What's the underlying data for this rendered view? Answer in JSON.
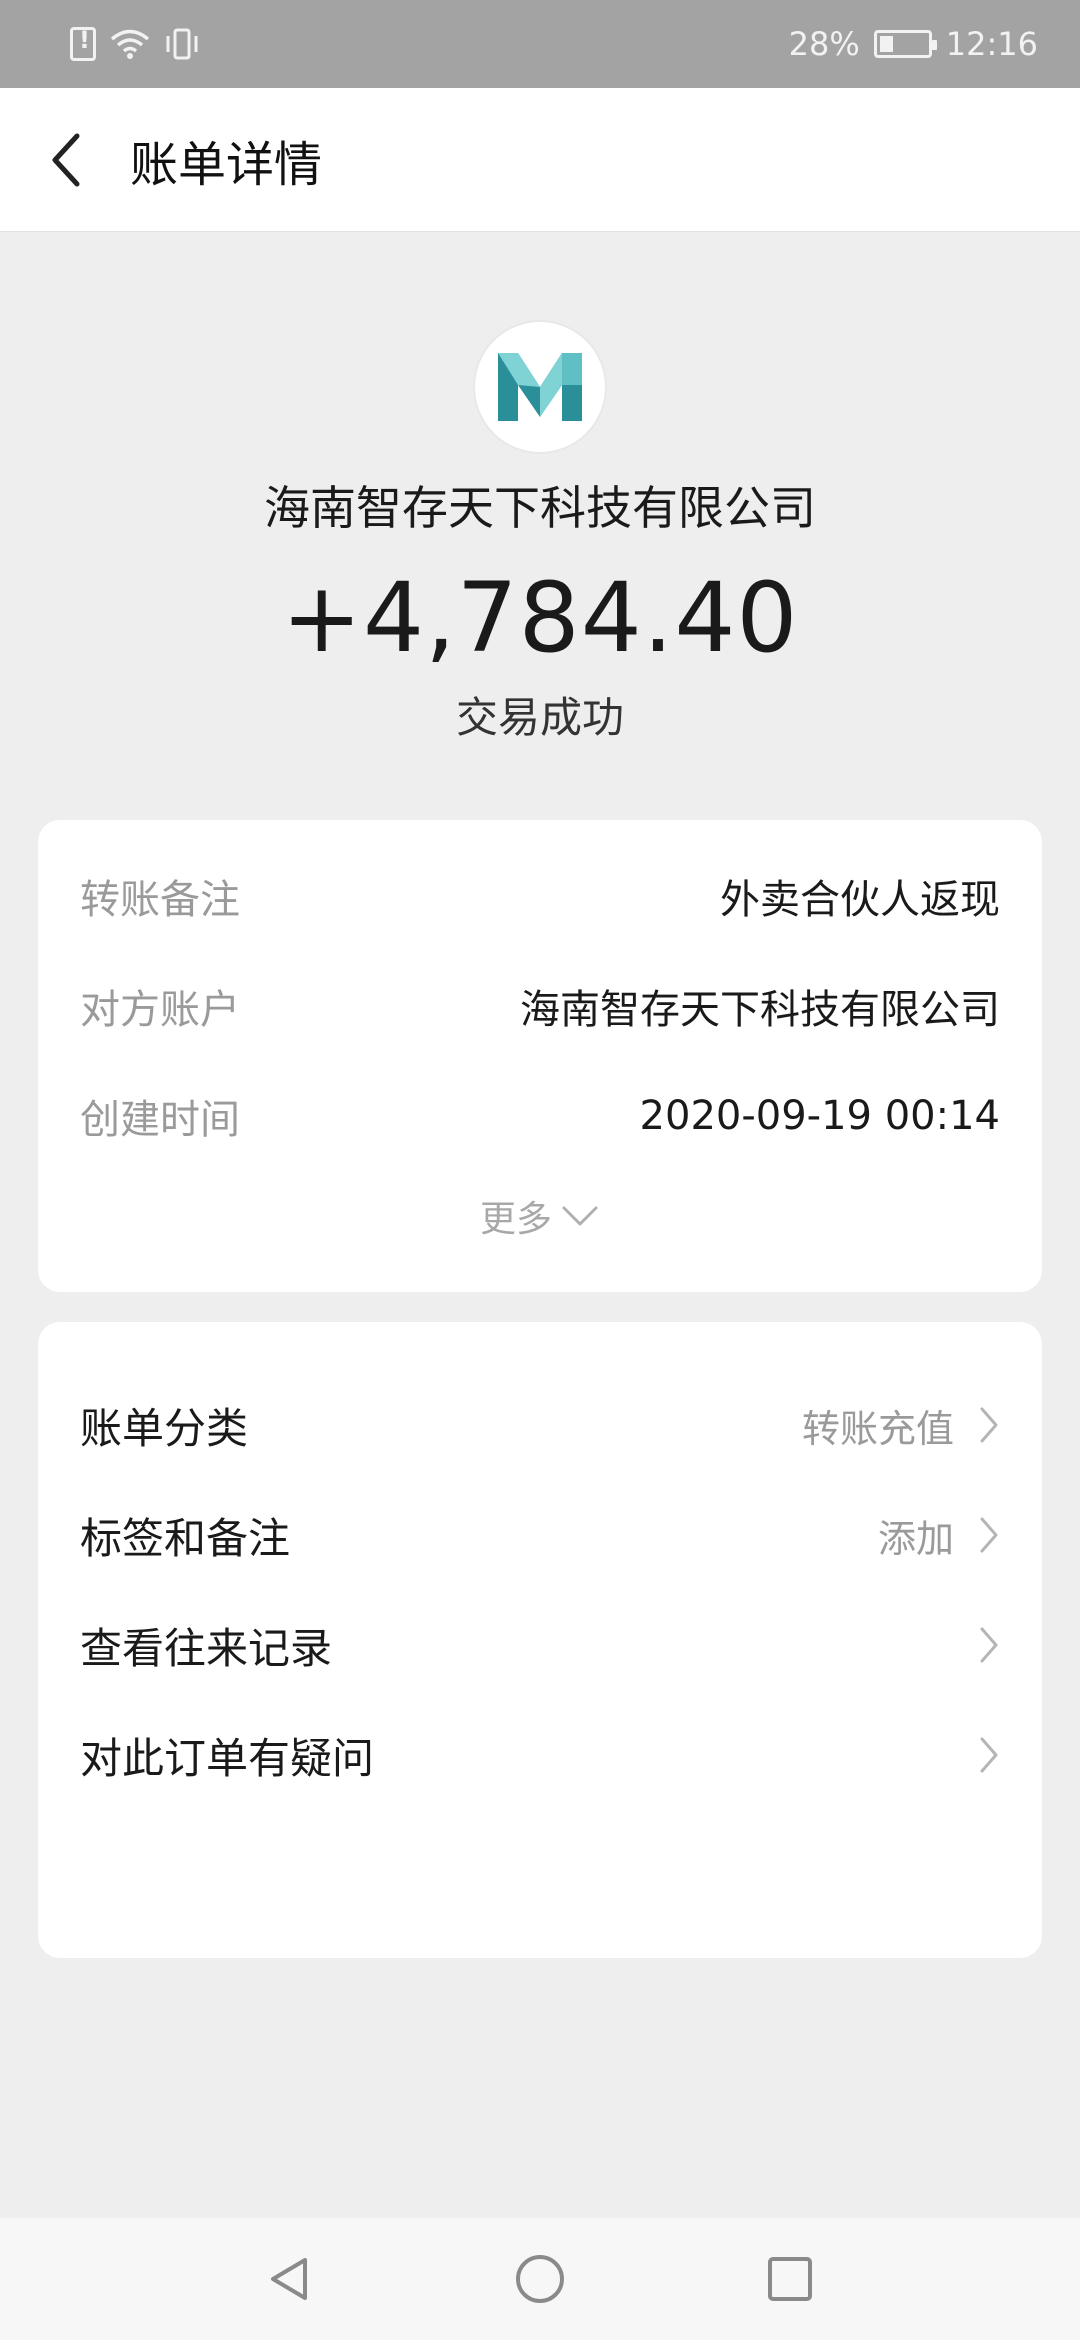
{
  "status_bar": {
    "battery": "28%",
    "time": "12:16",
    "battery_level": 0.28,
    "icons": [
      "sim-alert-icon",
      "wifi-icon",
      "vibrate-icon",
      "battery-icon"
    ]
  },
  "header": {
    "back_icon": "chevron-left-icon",
    "title": "账单详情"
  },
  "summary": {
    "merchant_logo": "M-logo",
    "merchant_name": "海南智存天下科技有限公司",
    "amount": "+4,784.40",
    "status": "交易成功"
  },
  "details": {
    "rows": [
      {
        "label": "转账备注",
        "value": "外卖合伙人返现"
      },
      {
        "label": "对方账户",
        "value": "海南智存天下科技有限公司"
      },
      {
        "label": "创建时间",
        "value": "2020-09-19 00:14"
      }
    ],
    "more_label": "更多",
    "more_icon": "chevron-down-icon"
  },
  "actions": {
    "rows": [
      {
        "label": "账单分类",
        "value": "转账充值"
      },
      {
        "label": "标签和备注",
        "value": "添加"
      },
      {
        "label": "查看往来记录",
        "value": ""
      },
      {
        "label": "对此订单有疑问",
        "value": ""
      }
    ],
    "chevron_icon": "chevron-right-icon"
  },
  "nav_bar": {
    "icons": [
      "nav-back-icon",
      "nav-home-icon",
      "nav-recents-icon"
    ]
  },
  "colors": {
    "page_background": "#eeeeef",
    "status_bar": "#a3a3a3",
    "logo_teal_light": "#7fd3d5",
    "logo_teal_dark": "#2a8f99",
    "label_gray": "#9a9a9a"
  }
}
